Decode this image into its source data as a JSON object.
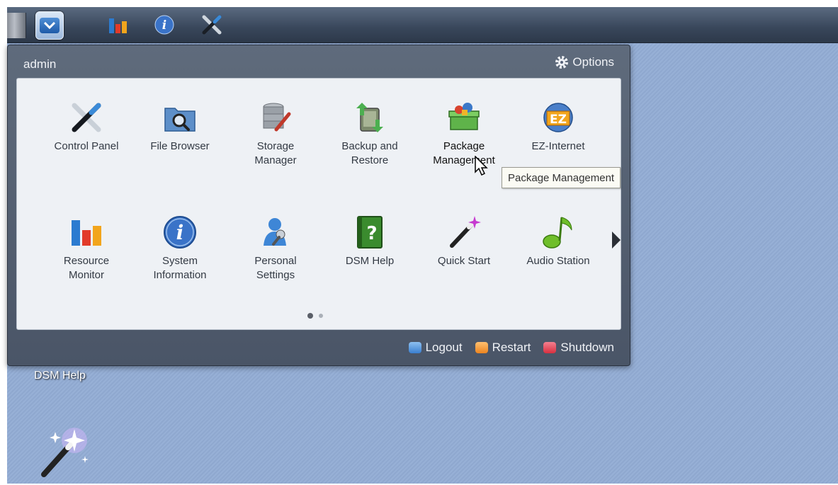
{
  "taskbar": {
    "buttons": [
      "main-menu-icon",
      "resource-monitor-icon",
      "system-info-icon",
      "control-panel-icon"
    ]
  },
  "menu": {
    "user": "admin",
    "options_label": "Options",
    "apps": [
      {
        "label": "Control Panel",
        "icon": "control-panel-icon"
      },
      {
        "label": "File Browser",
        "icon": "file-browser-icon"
      },
      {
        "label": "Storage\nManager",
        "icon": "storage-manager-icon"
      },
      {
        "label": "Backup and\nRestore",
        "icon": "backup-restore-icon"
      },
      {
        "label": "Package\nManagement",
        "icon": "package-management-icon"
      },
      {
        "label": "EZ-Internet",
        "icon": "ez-internet-icon"
      },
      {
        "label": "Resource\nMonitor",
        "icon": "resource-monitor-icon"
      },
      {
        "label": "System\nInformation",
        "icon": "system-info-icon"
      },
      {
        "label": "Personal\nSettings",
        "icon": "personal-settings-icon"
      },
      {
        "label": "DSM Help",
        "icon": "dsm-help-icon"
      },
      {
        "label": "Quick Start",
        "icon": "quick-start-icon"
      },
      {
        "label": "Audio Station",
        "icon": "audio-station-icon"
      }
    ],
    "pages": {
      "current": 1,
      "total": 2
    },
    "footer": {
      "logout": "Logout",
      "restart": "Restart",
      "shutdown": "Shutdown"
    }
  },
  "tooltip": "Package Management",
  "desktop": {
    "icons": [
      {
        "label": "DSM Help"
      },
      {
        "label": ""
      }
    ]
  },
  "colors": {
    "logout": "#4a8fd8",
    "restart": "#f0902a",
    "shutdown": "#e03a4a"
  }
}
